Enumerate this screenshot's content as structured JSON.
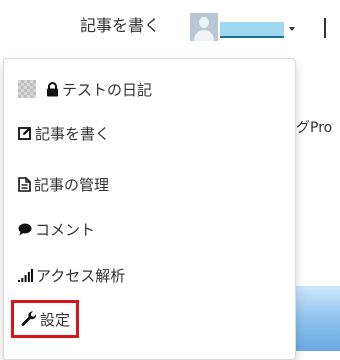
{
  "header": {
    "write_label": "記事を書く"
  },
  "background": {
    "partial_text": "グPro"
  },
  "dropdown": {
    "items": [
      {
        "label": "テストの日記",
        "icon": "lock-icon"
      },
      {
        "label": "記事を書く",
        "icon": "edit-icon"
      },
      {
        "label": "記事の管理",
        "icon": "document-icon"
      },
      {
        "label": "コメント",
        "icon": "comment-icon"
      },
      {
        "label": "アクセス解析",
        "icon": "signal-bars-icon"
      },
      {
        "label": "設定",
        "icon": "wrench-icon"
      }
    ]
  },
  "colors": {
    "highlight_border": "#d9141b",
    "username_mask": "#9fd8f0"
  }
}
